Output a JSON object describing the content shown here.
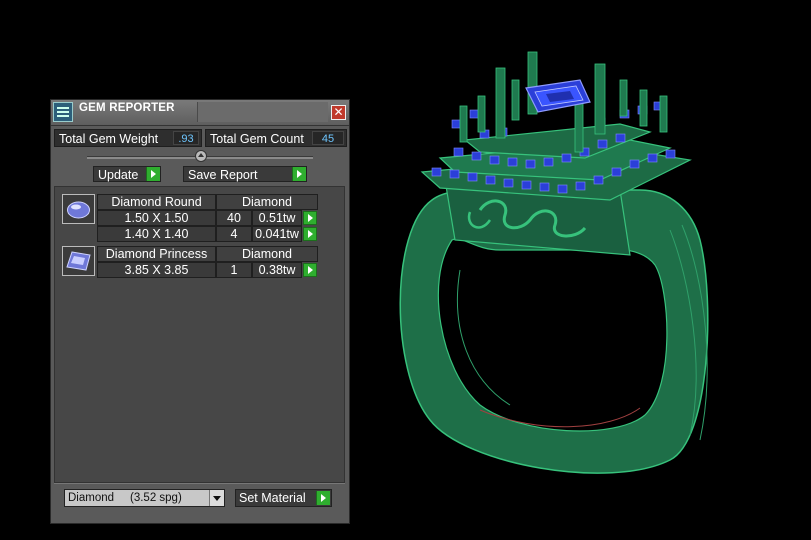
{
  "window": {
    "title": "GEM REPORTER",
    "close_glyph": "✕"
  },
  "stats": {
    "total_weight_label": "Total Gem Weight",
    "total_weight_value": ".93",
    "total_count_label": "Total Gem Count",
    "total_count_value": "45"
  },
  "toolbar": {
    "update_label": "Update",
    "save_report_label": "Save Report"
  },
  "gems": [
    {
      "name": "Diamond Round",
      "material": "Diamond",
      "icon": "round-gem-icon",
      "rows": [
        {
          "size": "1.50 X 1.50",
          "count": "40",
          "weight": "0.51tw"
        },
        {
          "size": "1.40 X 1.40",
          "count": "4",
          "weight": "0.041tw"
        }
      ]
    },
    {
      "name": "Diamond Princess",
      "material": "Diamond",
      "icon": "princess-gem-icon",
      "rows": [
        {
          "size": "3.85 X 3.85",
          "count": "1",
          "weight": "0.38tw"
        }
      ]
    }
  ],
  "footer": {
    "material_selected": "Diamond     (3.52 spg)",
    "set_material_label": "Set Material"
  },
  "colors": {
    "ring_green": "#1f7a4f",
    "gem_blue": "#2b3fd9",
    "accent_green": "#2fae2f"
  }
}
